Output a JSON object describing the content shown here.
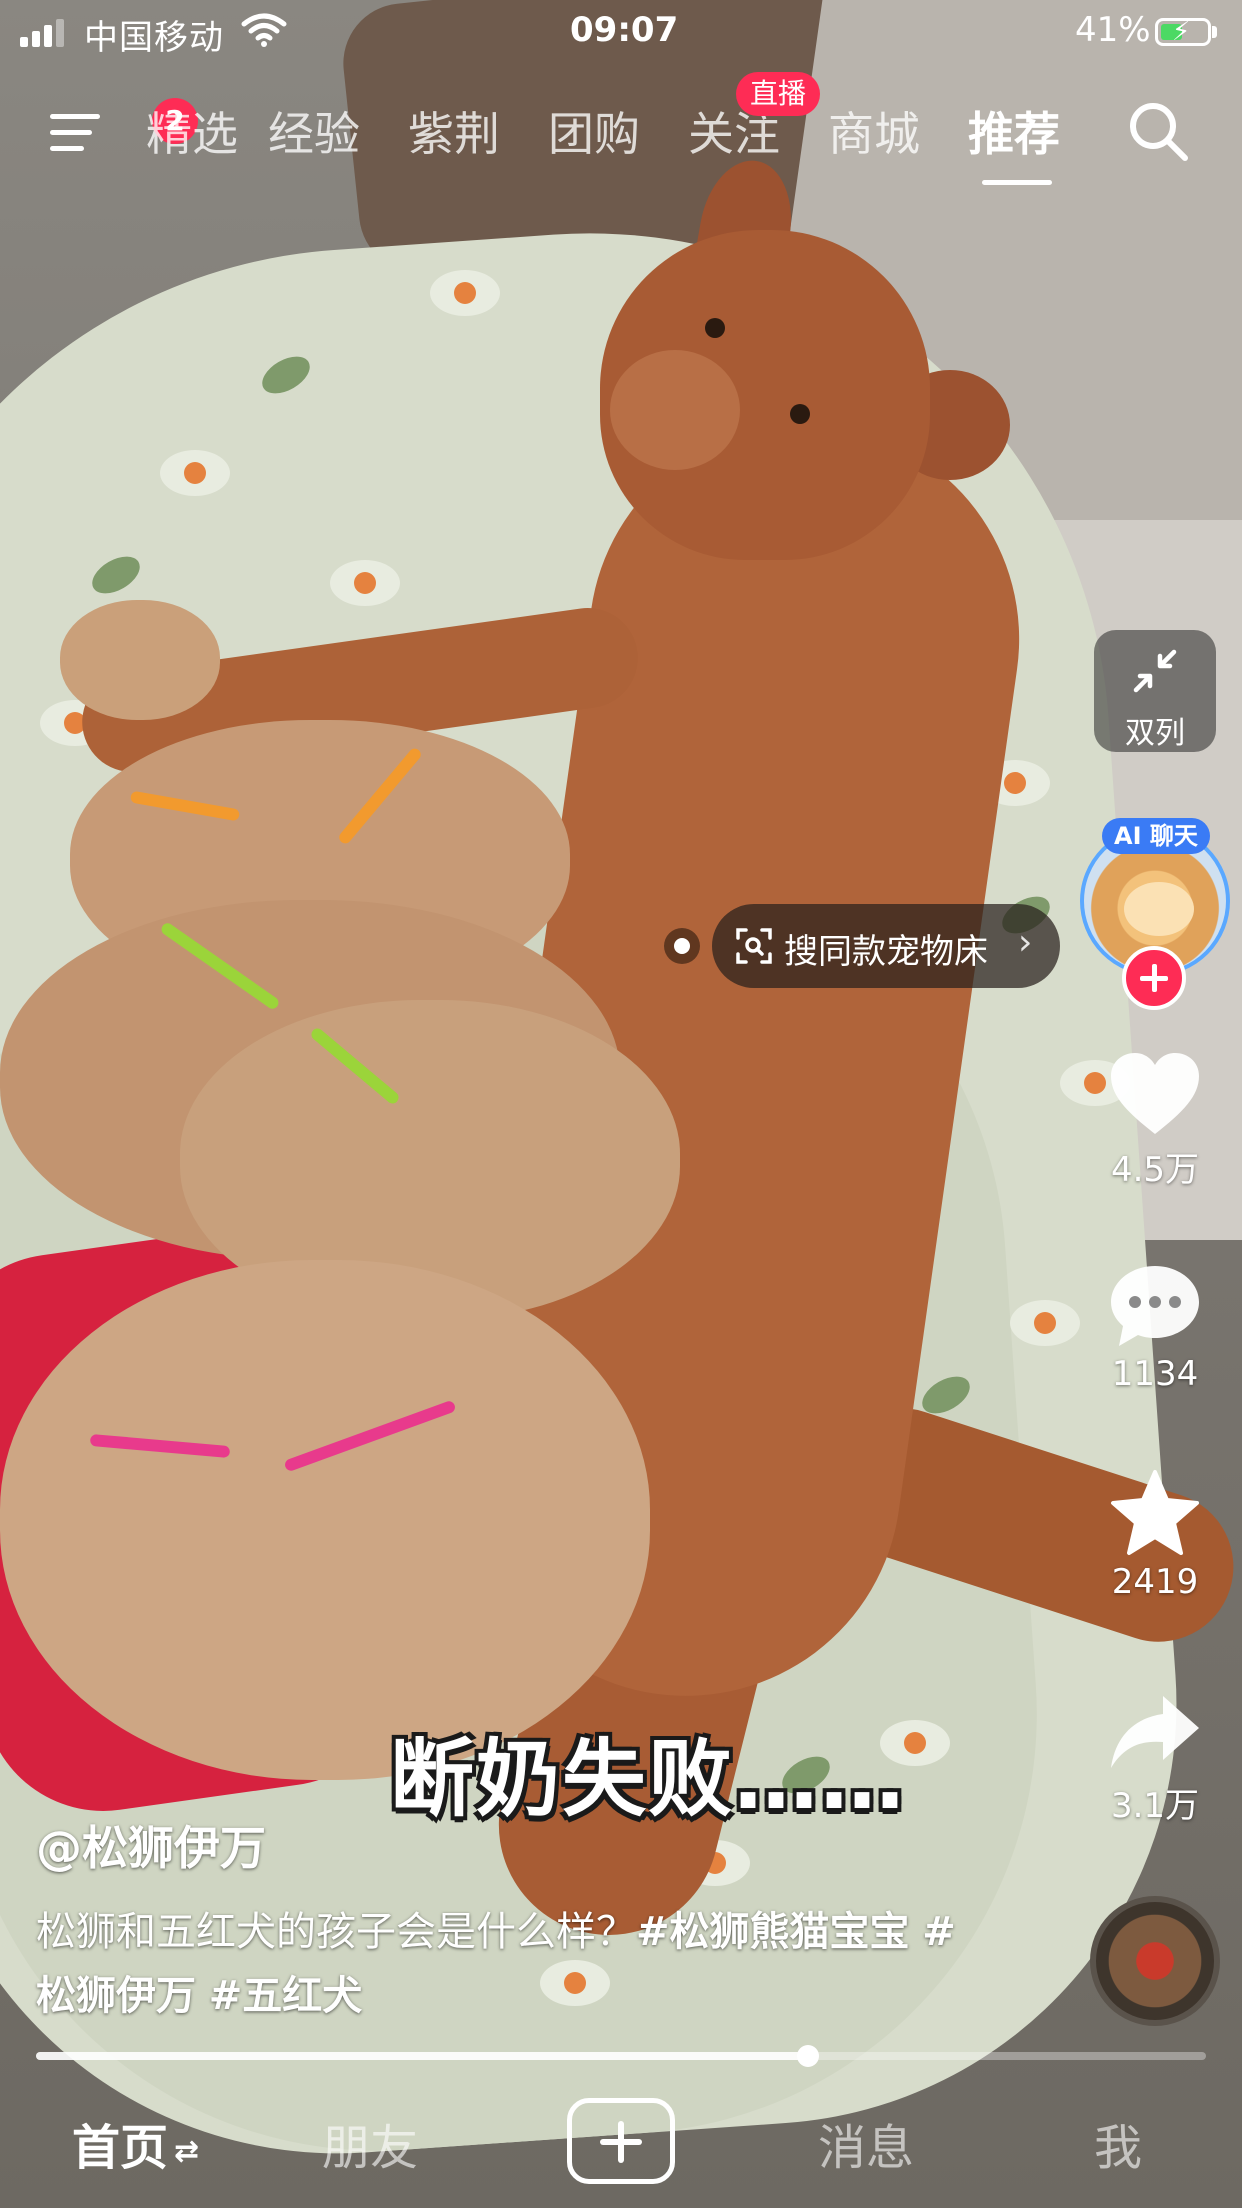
{
  "status_bar": {
    "carrier": "中国移动",
    "time": "09:07",
    "battery": "41%",
    "battery_level": 0.41
  },
  "top_nav": {
    "menu_badge": "2",
    "tabs": [
      {
        "label": "精选"
      },
      {
        "label": "经验"
      },
      {
        "label": "紫荆"
      },
      {
        "label": "团购"
      },
      {
        "label": "关注",
        "badge": "直播"
      },
      {
        "label": "商城"
      },
      {
        "label": "推荐",
        "active": true
      }
    ],
    "search_icon": "search-icon"
  },
  "right_rail": {
    "dual_column_label": "双列",
    "ai_badge": "AI 聊天",
    "like_count": "4.5万",
    "comment_count": "1134",
    "favorite_count": "2419",
    "share_count": "3.1万"
  },
  "product": {
    "label": "搜同款宠物床"
  },
  "video": {
    "subtitle": "断奶失败……",
    "author": "@松狮伊万",
    "description_text": "松狮和五红犬的孩子会是什么样？",
    "tags": [
      "#松狮熊猫宝宝",
      "#松狮伊万",
      "#五红犬"
    ],
    "progress": 0.66
  },
  "bottom_nav": {
    "home": "首页",
    "friends": "朋友",
    "messages": "消息",
    "me": "我"
  },
  "colors": {
    "accent": "#fe2c55",
    "ai_blue": "#3a7bf5",
    "battery_green": "#4cd964"
  }
}
